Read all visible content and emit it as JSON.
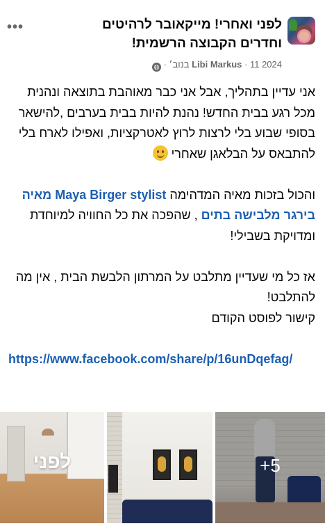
{
  "header": {
    "title_line1": "לפני ואחרי! מייקאובר לרהיטים",
    "title_line2": "וחדרים הקבוצה הרשמית!",
    "author": "Libi Markus",
    "date": "11 2024 בנוב׳",
    "separator": "·",
    "visibility_icon": "globe-icon",
    "more_icon": "•••"
  },
  "post": {
    "paragraph1": "אני עדיין בתהליך, אבל אני כבר מאוהבת בתוצאה ונהנית מכל רגע בבית החדש! נהנת להיות בבית בערבים ,להישאר בסופי שבוע בלי לרצות לרוץ לאטרקציות, ואפילו לארח בלי להתבאס על הבלאגן שאחרי",
    "paragraph2_prefix": "והכול בזכות מאיה המדהימה",
    "mention": "Maya Birger stylist מאיה בירגר מלבישה בתים",
    "paragraph2_suffix": ", שהפכה את כל החוויה למיוחדת ומדויקת בשבילי!",
    "paragraph3": "אז כל מי שעדיין מתלבט על המרתון הלבשת הבית , אין מה להתלבט!",
    "paragraph4": "קישור לפוסט הקודם",
    "link": "https://www.facebook.com/share/p/16unDqefag/"
  },
  "photos": {
    "photo1_label": "לפני",
    "photo3_more_count": "+5"
  },
  "colors": {
    "text": "#050505",
    "meta": "#65676b",
    "link": "#1c5fb3"
  }
}
